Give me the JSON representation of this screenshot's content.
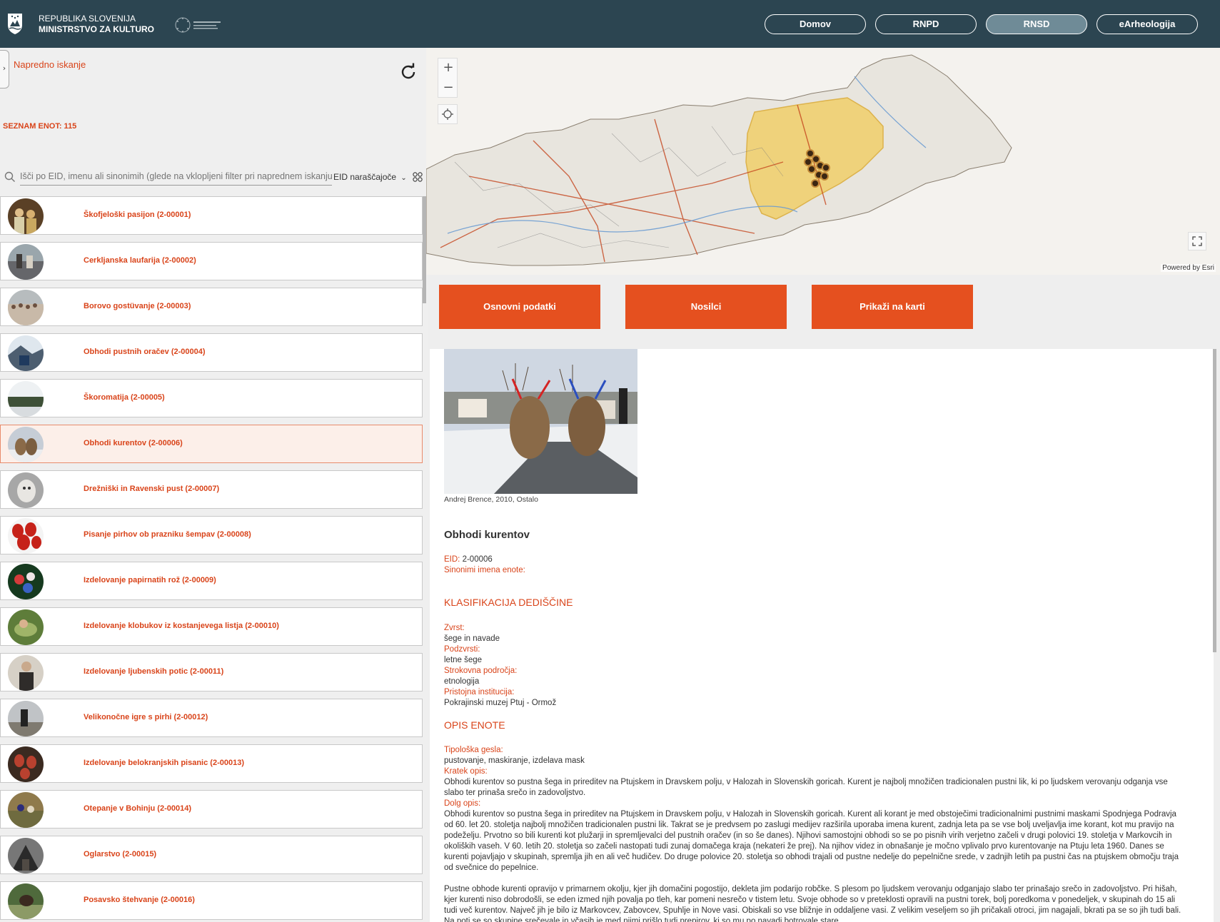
{
  "header": {
    "ministry_line1": "REPUBLIKA SLOVENIJA",
    "ministry_line2": "MINISTRSTVO ZA KULTURO",
    "nav": [
      {
        "label": "Domov",
        "active": false
      },
      {
        "label": "RNPD",
        "active": false
      },
      {
        "label": "RNSD",
        "active": true
      },
      {
        "label": "eArheologija",
        "active": false
      }
    ]
  },
  "sidebar": {
    "advanced_search": "Napredno iskanje",
    "unit_count": "SEZNAM ENOT: 115",
    "search_placeholder": "Išči po EID, imenu ali sinonimih (glede na vklopljeni filter pri naprednem iskanju)",
    "sort_label": "EID naraščajoče",
    "items": [
      {
        "label": "Škofjeloški pasijon  (2-00001)"
      },
      {
        "label": "Cerkljanska laufarija  (2-00002)"
      },
      {
        "label": "Borovo gostüvanje  (2-00003)"
      },
      {
        "label": "Obhodi pustnih oračev  (2-00004)"
      },
      {
        "label": "Škoromatija  (2-00005)"
      },
      {
        "label": "Obhodi kurentov  (2-00006)",
        "selected": true
      },
      {
        "label": "Drežniški in Ravenski pust  (2-00007)"
      },
      {
        "label": "Pisanje pirhov ob prazniku šempav  (2-00008)"
      },
      {
        "label": "Izdelovanje papirnatih rož  (2-00009)"
      },
      {
        "label": "Izdelovanje klobukov iz kostanjevega listja  (2-00010)"
      },
      {
        "label": "Izdelovanje ljubenskih potic  (2-00011)"
      },
      {
        "label": "Velikonočne igre s pirhi  (2-00012)"
      },
      {
        "label": "Izdelovanje belokranjskih pisanic  (2-00013)"
      },
      {
        "label": "Otepanje v Bohinju  (2-00014)"
      },
      {
        "label": "Oglarstvo  (2-00015)"
      },
      {
        "label": "Posavsko štehvanje  (2-00016)"
      }
    ]
  },
  "map": {
    "powered_by": "Powered by Esri",
    "zoom_in": "+",
    "zoom_out": "−"
  },
  "tabs": {
    "basic": "Osnovni podatki",
    "holders": "Nosilci",
    "show_on_map": "Prikaži na karti"
  },
  "detail": {
    "photo_caption": "Andrej Brence, 2010, Ostalo",
    "title": "Obhodi kurentov",
    "eid_label": "EID:",
    "eid_value": " 2-00006",
    "synonyms_label": "Sinonimi imena enote:",
    "classification_heading": "KLASIFIKACIJA DEDIŠČINE",
    "type_label": "Zvrst:",
    "type_value": "šege in navade",
    "subtype_label": "Podzvrsti:",
    "subtype_value": "letne šege",
    "fields_label": "Strokovna področja:",
    "fields_value": "etnologija",
    "institution_label": "Pristojna institucija:",
    "institution_value": "Pokrajinski muzej Ptuj - Ormož",
    "description_heading": "OPIS ENOTE",
    "keywords_label": "Tipološka gesla:",
    "keywords_value": "pustovanje, maskiranje, izdelava mask",
    "short_label": "Kratek opis:",
    "short_value": "Obhodi kurentov so pustna šega in prireditev na Ptujskem in Dravskem polju, v Halozah in Slovenskih goricah. Kurent je najbolj množičen tradicionalen pustni lik, ki po ljudskem verovanju odganja vse slabo ter prinaša srečo in zadovoljstvo.",
    "long_label": "Dolg opis:",
    "long_value": "Obhodi kurentov so pustna šega in prireditev na Ptujskem in Dravskem polju, v Halozah in Slovenskih goricah. Kurent ali korant je med obstoječimi tradicionalnimi pustnimi maskami Spodnjega Podravja od 60. let 20. stoletja najbolj množičen tradicionalen pustni lik. Takrat se je predvsem po zaslugi medijev razširila uporaba imena kurent, zadnja leta pa se vse bolj uveljavlja ime korant, kot mu pravijo na podeželju. Prvotno so bili kurenti kot plužarji in spremljevalci del pustnih oračev (in so še danes). Njihovi samostojni obhodi so se po pisnih virih verjetno začeli v drugi polovici 19. stoletja v Markovcih in okoliških vaseh. V 60. letih 20. stoletja so začeli nastopati tudi zunaj domačega kraja (nekateri že prej). Na njihov videz in obnašanje je močno vplivalo prvo kurentovanje na Ptuju leta 1960. Danes se kurenti pojavljajo v skupinah, spremlja jih en ali več hudičev. Do druge polovice 20. stoletja so obhodi trajali od pustne nedelje do pepelnične srede, v zadnjih letih pa pustni čas na ptujskem območju traja od svečnice do pepelnice.",
    "para2": "Pustne obhode kurenti opravijo v primarnem okolju, kjer jih domačini pogostijo, dekleta jim podarijo robčke. S plesom po ljudskem verovanju odganjajo slabo ter prinašajo srečo in zadovoljstvo. Pri hišah, kjer kurenti niso dobrodošli, se eden izmed njih povalja po tleh, kar pomeni nesrečo v tistem letu. Svoje obhode so v preteklosti opravili na pustni torek, bolj poredkoma v ponedeljek, v skupinah do 15 ali tudi več kurentov. Največ jih je bilo iz Markovcev, Zabovcev, Spuhlje in Nove vasi. Obiskali so vse bližnje in oddaljene vasi. Z velikim veseljem so jih pričakali otroci, jim nagajali, bkrati pa se so jih tudi bali. Na poti se so skupine srečevale in včasih je med njimi prišlo tudi prepirov, ki so mu po navadi botrovale stare"
  }
}
